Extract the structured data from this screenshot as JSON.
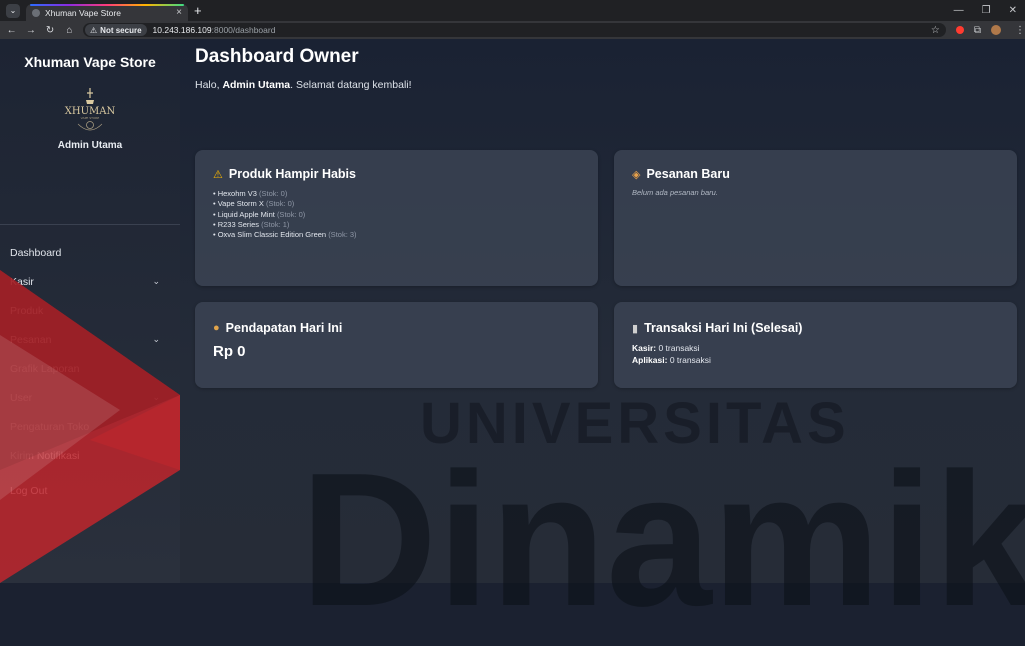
{
  "browser": {
    "tab_title": "Xhuman Vape Store",
    "tab_close": "×",
    "new_tab": "+",
    "not_secure": "Not secure",
    "url_host": "10.243.186.109",
    "url_rest": ":8000/dashboard"
  },
  "sidebar": {
    "brand": "Xhuman Vape Store",
    "logo_text": "XHUMAN",
    "logo_subtext": "VAPE STORE",
    "user_name": "Admin Utama",
    "items": [
      {
        "label": "Dashboard",
        "has_chevron": false
      },
      {
        "label": "Kasir",
        "has_chevron": true
      },
      {
        "label": "Produk",
        "has_chevron": false
      },
      {
        "label": "Pesanan",
        "has_chevron": true
      },
      {
        "label": "Grafik Laporan",
        "has_chevron": false
      },
      {
        "label": "User",
        "has_chevron": true
      },
      {
        "label": "Pengaturan Toko",
        "has_chevron": false
      },
      {
        "label": "Kirim Notifikasi",
        "has_chevron": false
      },
      {
        "label": "Log Out",
        "has_chevron": false
      }
    ]
  },
  "main": {
    "title": "Dashboard Owner",
    "greeting_prefix": "Halo, ",
    "greeting_name": "Admin Utama",
    "greeting_suffix": ". Selamat datang kembali!"
  },
  "cards": {
    "low_stock": {
      "title": "Produk Hampir Habis",
      "icon": "warning-icon",
      "items": [
        {
          "name": "Hexohm V3",
          "note": "(Stok: 0)"
        },
        {
          "name": "Vape Storm X",
          "note": "(Stok: 0)"
        },
        {
          "name": "Liquid Apple Mint",
          "note": "(Stok: 0)"
        },
        {
          "name": "R233 Series",
          "note": "(Stok: 1)"
        },
        {
          "name": "Oxva Slim Classic Edition Green",
          "note": "(Stok: 3)"
        }
      ]
    },
    "new_orders": {
      "title": "Pesanan Baru",
      "icon": "package-icon",
      "empty_text": "Belum ada pesanan baru."
    },
    "revenue": {
      "title": "Pendapatan Hari Ini",
      "icon": "money-bag-icon",
      "value": "Rp 0"
    },
    "transactions": {
      "title": "Transaksi Hari Ini (Selesai)",
      "icon": "receipt-icon",
      "kasir_label": "Kasir:",
      "kasir_value": "0 transaksi",
      "app_label": "Aplikasi:",
      "app_value": "0 transaksi"
    }
  },
  "watermark": {
    "line1": "UNIVERSITAS",
    "line2": "Dinamik"
  },
  "colors": {
    "sidebar_bg": "#1d2433",
    "main_bg": "#1a2233",
    "card_bg": "#3c4454",
    "watermark_red": "#c0262d",
    "warning": "#f5b400"
  }
}
